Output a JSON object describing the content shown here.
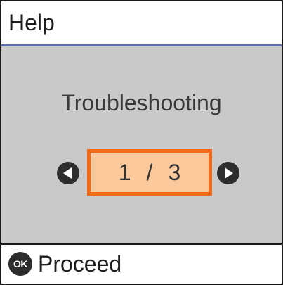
{
  "header": {
    "title": "Help",
    "divider_color": "#5a6fa8"
  },
  "main": {
    "title": "Troubleshooting",
    "background_color": "#c9c9c9",
    "pager": {
      "current": "1",
      "separator": "/",
      "total": "3",
      "border_color": "#f26a16",
      "fill_color": "#fbc99c"
    },
    "left_arrow_icon": "arrow-left-icon",
    "right_arrow_icon": "arrow-right-icon"
  },
  "footer": {
    "button_icon_text": "OK",
    "button_label": "Proceed"
  }
}
